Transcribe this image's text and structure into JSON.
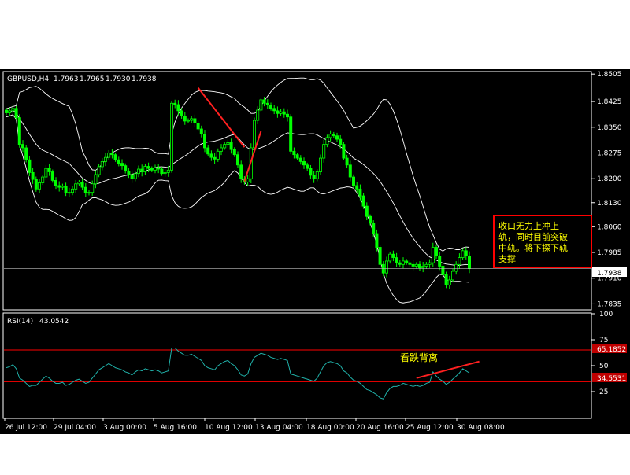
{
  "chart_data": [
    {
      "type": "candlestick",
      "symbol_header": "GBPUSD,H4",
      "ohlc_readout": [
        "1.7963",
        "1.7965",
        "1.7930",
        "1.7938"
      ],
      "last_price": "1.7938",
      "y_ticks": [
        "1.8505",
        "1.8425",
        "1.8350",
        "1.8275",
        "1.8200",
        "1.8130",
        "1.8060",
        "1.7985",
        "1.7910",
        "1.7835"
      ],
      "x_ticks": [
        "26 Jul 12:00",
        "29 Jul 04:00",
        "3 Aug 00:00",
        "5 Aug 16:00",
        "10 Aug 12:00",
        "13 Aug 04:00",
        "18 Aug 00:00",
        "20 Aug 16:00",
        "25 Aug 12:00",
        "30 Aug 08:00"
      ],
      "ylim": [
        1.782,
        1.851
      ],
      "closes": [
        1.8392,
        1.8398,
        1.8405,
        1.8378,
        1.83,
        1.829,
        1.8255,
        1.8218,
        1.8198,
        1.817,
        1.8188,
        1.8205,
        1.823,
        1.822,
        1.8195,
        1.818,
        1.8175,
        1.8178,
        1.816,
        1.816,
        1.817,
        1.8185,
        1.819,
        1.8175,
        1.8158,
        1.816,
        1.8185,
        1.8212,
        1.8235,
        1.825,
        1.8262,
        1.8275,
        1.827,
        1.8255,
        1.8245,
        1.8238,
        1.8222,
        1.8212,
        1.82,
        1.8215,
        1.8228,
        1.822,
        1.8236,
        1.823,
        1.8225,
        1.8232,
        1.8228,
        1.8215,
        1.8218,
        1.8225,
        1.842,
        1.8416,
        1.8398,
        1.8383,
        1.8368,
        1.837,
        1.8375,
        1.8362,
        1.8345,
        1.833,
        1.829,
        1.8272,
        1.8262,
        1.8257,
        1.828,
        1.829,
        1.83,
        1.8305,
        1.8285,
        1.827,
        1.824,
        1.82,
        1.819,
        1.82,
        1.829,
        1.837,
        1.84,
        1.843,
        1.842,
        1.8415,
        1.8405,
        1.8398,
        1.839,
        1.8395,
        1.8388,
        1.838,
        1.828,
        1.827,
        1.826,
        1.825,
        1.824,
        1.823,
        1.821,
        1.82,
        1.822,
        1.826,
        1.83,
        1.832,
        1.833,
        1.8325,
        1.8315,
        1.83,
        1.826,
        1.824,
        1.8205,
        1.818,
        1.817,
        1.815,
        1.812,
        1.809,
        1.807,
        1.804,
        1.8,
        1.795,
        1.7925,
        1.796,
        1.798,
        1.797,
        1.7955,
        1.795,
        1.796,
        1.7955,
        1.795,
        1.7945,
        1.795,
        1.794,
        1.7945,
        1.795,
        1.7955,
        1.8,
        1.7975,
        1.7945,
        1.792,
        1.789,
        1.7905,
        1.793,
        1.795,
        1.797,
        1.799,
        1.7975,
        1.7938
      ],
      "annotations": [
        {
          "type": "trendline",
          "color": "#ff2020",
          "points": [
            [
              58,
              1.8465
            ],
            [
              72,
              1.8292
            ]
          ]
        },
        {
          "type": "trendline",
          "color": "#ff2020",
          "points": [
            [
              72,
              1.8192
            ],
            [
              77,
              1.8338
            ]
          ]
        }
      ],
      "annotation_box": {
        "text_lines": [
          "收口无力上冲上",
          "轨，同时目前突破",
          "中轨。将下探下轨",
          "支撑"
        ],
        "text_color": "#ffff00",
        "border_color": "#ff0000"
      }
    },
    {
      "type": "line",
      "label": "RSI(14)",
      "value_readout": "43.0542",
      "y_ticks": [
        "100",
        "75",
        "50",
        "25"
      ],
      "ylim": [
        0,
        100
      ],
      "levels": [
        {
          "value": 65.1852,
          "label": "65.1852"
        },
        {
          "value": 34.5531,
          "label": "34.5531"
        }
      ],
      "values": [
        48,
        49,
        51,
        47,
        38,
        36,
        33,
        30,
        31,
        31,
        34,
        37,
        40,
        38,
        35,
        33,
        33,
        34,
        31,
        32,
        34,
        36,
        37,
        35,
        33,
        34,
        38,
        42,
        46,
        48,
        50,
        52,
        50,
        48,
        47,
        46,
        44,
        43,
        41,
        44,
        46,
        45,
        47,
        46,
        45,
        46,
        45,
        43,
        44,
        45,
        67,
        67,
        64,
        62,
        60,
        60,
        61,
        59,
        57,
        55,
        50,
        48,
        47,
        46,
        50,
        52,
        54,
        55,
        52,
        50,
        46,
        41,
        40,
        42,
        52,
        58,
        60,
        62,
        61,
        60,
        58,
        57,
        56,
        57,
        56,
        55,
        42,
        41,
        40,
        39,
        38,
        37,
        36,
        35,
        38,
        44,
        50,
        53,
        54,
        53,
        52,
        50,
        45,
        43,
        39,
        36,
        35,
        33,
        30,
        27,
        26,
        24,
        22,
        19,
        18,
        24,
        28,
        30,
        30,
        31,
        33,
        32,
        31,
        30,
        31,
        30,
        31,
        33,
        34,
        44,
        40,
        37,
        35,
        32,
        34,
        37,
        40,
        43,
        47,
        45,
        43
      ],
      "annotation_label": "看跌背离",
      "annotation_color": "#ffff00",
      "annotations": [
        {
          "type": "trendline",
          "color": "#ff2020",
          "points": [
            [
              124,
              38
            ],
            [
              143,
              54
            ]
          ]
        }
      ]
    }
  ],
  "colors": {
    "background": "#000000",
    "frame": "#ffffff",
    "candle": "#00ff00",
    "bands": "#ffffff",
    "rsi_line": "#20b2aa",
    "level_line": "#ff0000",
    "level_box": "#c00000",
    "price_line": "#c0c0c0"
  }
}
